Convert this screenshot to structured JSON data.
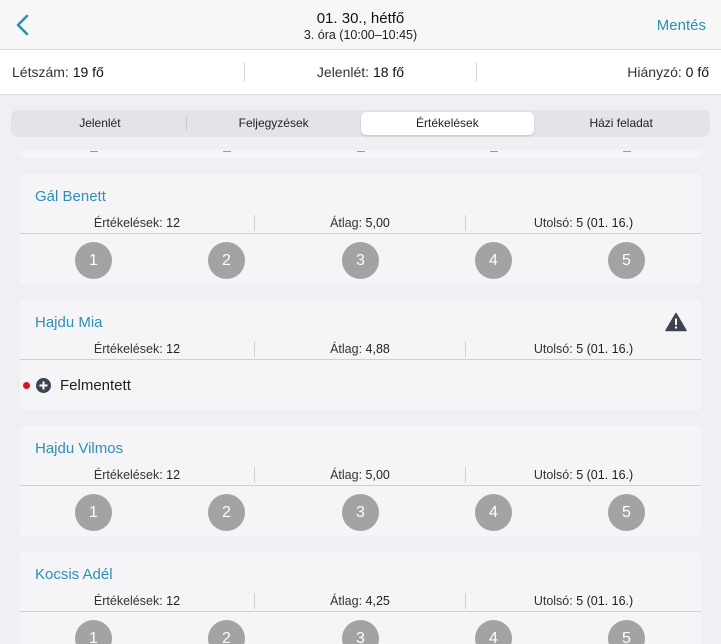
{
  "nav": {
    "title": "01. 30., hétfő",
    "subtitle": "3. óra (10:00–10:45)",
    "save_label": "Mentés"
  },
  "stats": {
    "headcount_label": "Létszám:",
    "headcount_value": "19 fő",
    "present_label": "Jelenlét:",
    "present_value": "18 fő",
    "absent_label": "Hiányzó:",
    "absent_value": "0 fő"
  },
  "tabs": [
    {
      "label": "Jelenlét"
    },
    {
      "label": "Feljegyzések"
    },
    {
      "label": "Értékelések"
    },
    {
      "label": "Házi feladat"
    }
  ],
  "active_tab": "Értékelések",
  "metric_labels": {
    "count": "Értékelések:",
    "average": "Átlag:",
    "last": "Utolsó:"
  },
  "grade_options": [
    "1",
    "2",
    "3",
    "4",
    "5"
  ],
  "students": [
    {
      "name": "Gál Benett",
      "count": "12",
      "average": "5,00",
      "last": "5 (01. 16.)"
    },
    {
      "name": "Hajdu Mia",
      "count": "12",
      "average": "4,88",
      "last": "5 (01. 16.)",
      "exempt_label": "Felmentett"
    },
    {
      "name": "Hajdu Vilmos",
      "count": "12",
      "average": "5,00",
      "last": "5 (01. 16.)"
    },
    {
      "name": "Kocsis Adél",
      "count": "12",
      "average": "4,25",
      "last": "5 (01. 16.)"
    }
  ],
  "colors": {
    "accent": "#2f8fb5",
    "grade_button": "#a3a3a6",
    "exempt_dot": "#e0101a",
    "background": "#efeff4"
  },
  "icons": {
    "back": "chevron-left-icon",
    "warning": "warning-triangle-icon",
    "exempt": "plus-circle-icon"
  }
}
